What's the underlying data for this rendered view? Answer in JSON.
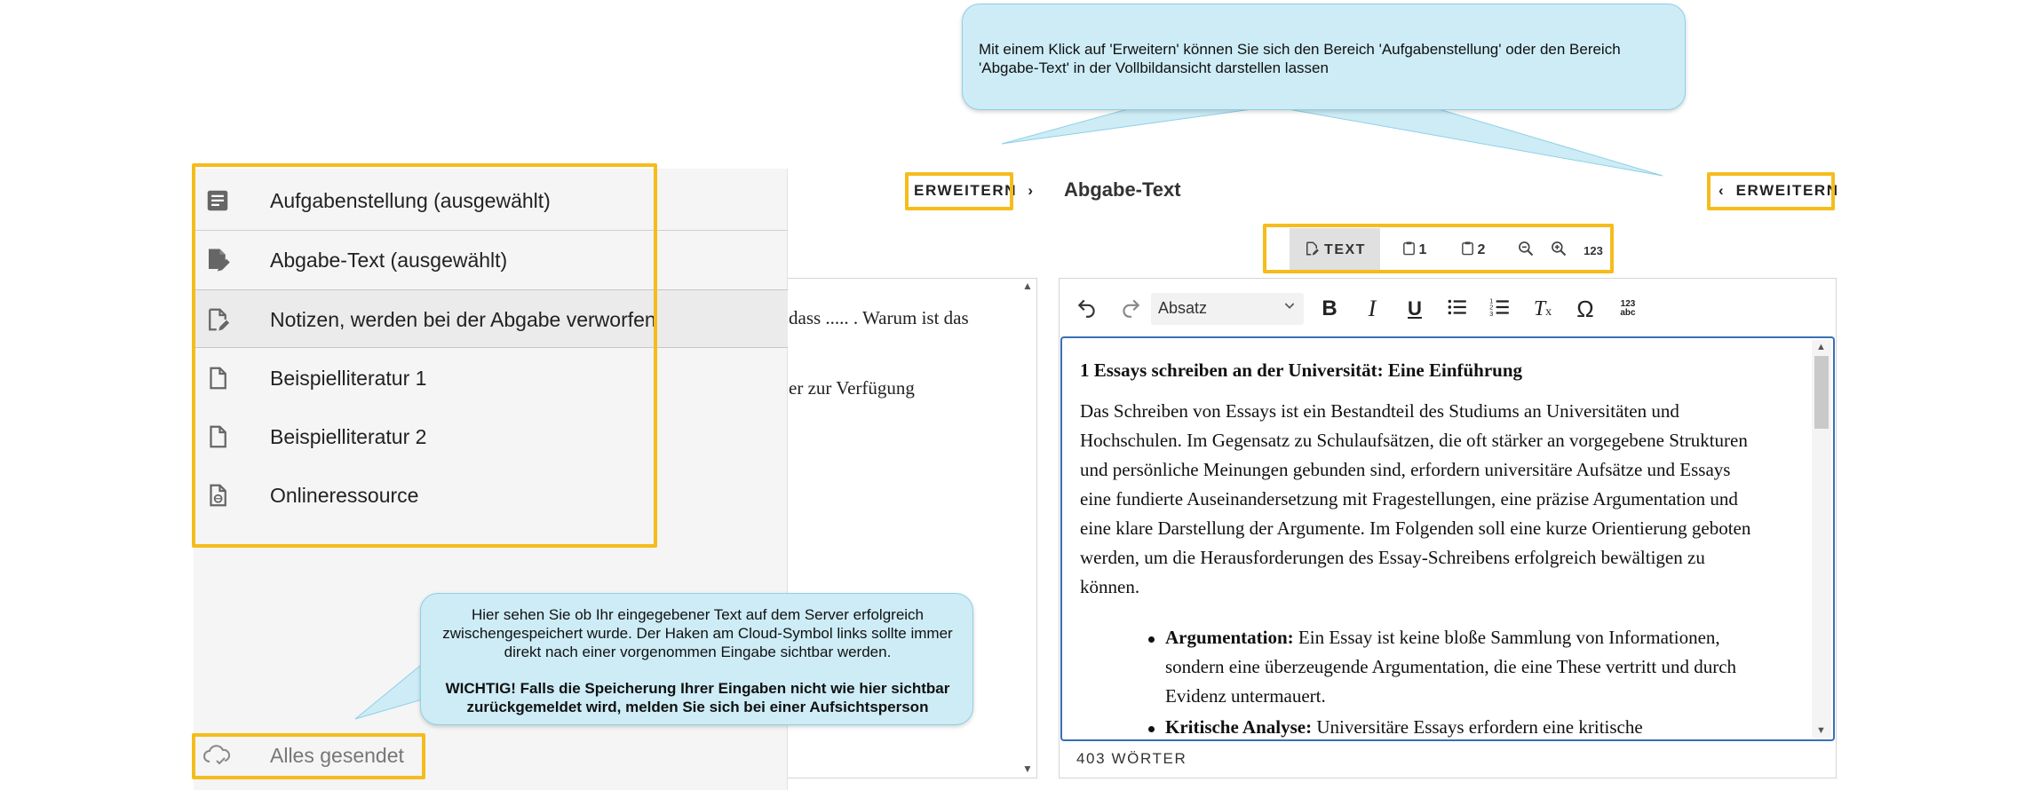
{
  "tooltip_top": {
    "text": "Mit einem Klick auf 'Erweitern' können Sie sich den Bereich 'Aufgabenstellung' oder den Bereich 'Abgabe-Text' in der Vollbildansicht darstellen lassen"
  },
  "tooltip_bottom": {
    "line1": "Hier sehen Sie ob Ihr eingegebener Text auf dem Server erfolgreich",
    "line2": "zwischengespeichert wurde. Der Haken am Cloud-Symbol links sollte immer",
    "line3": "direkt nach einer vorgenommen Eingabe sichtbar werden.",
    "warning1": "WICHTIG! Falls die Speicherung Ihrer Eingaben nicht wie hier sichtbar",
    "warning2": "zurückgemeldet wird, melden Sie sich bei einer Aufsichtsperson"
  },
  "sidebar": {
    "items": [
      {
        "label": "Aufgabenstellung (ausgewählt)",
        "icon": "document-icon"
      },
      {
        "label": "Abgabe-Text (ausgewählt)",
        "icon": "edit-document-icon"
      },
      {
        "label": "Notizen, werden bei der Abgabe verworfen",
        "icon": "edit-outline-icon"
      },
      {
        "label": "Beispielliteratur 1",
        "icon": "file-outline-icon"
      },
      {
        "label": "Beispielliteratur 2",
        "icon": "file-outline-icon"
      },
      {
        "label": "Onlineressource",
        "icon": "web-resource-icon"
      }
    ],
    "save_status": "Alles gesendet"
  },
  "left_panel": {
    "expand_label": "ERWEITERN",
    "text_line1": "dass ..... . Warum ist das",
    "text_line2": "er zur Verfügung"
  },
  "right_panel": {
    "title": "Abgabe-Text",
    "expand_label": "ERWEITERN",
    "view_tabs": {
      "text": "TEXT",
      "note1": "1",
      "note2": "2",
      "chars": "123"
    },
    "format_select": "Absatz",
    "heading": "1 Essays schreiben an der Universität: Eine Einführung",
    "para_lines": [
      "Das Schreiben von Essays ist ein Bestandteil des Studiums an Universitäten und",
      "Hochschulen. Im Gegensatz zu Schulaufsätzen, die oft stärker an vorgegebene Strukturen",
      "und persönliche Meinungen gebunden sind, erfordern universitäre Aufsätze und Essays",
      "eine fundierte Auseinandersetzung mit Fragestellungen, eine präzise Argumentation und",
      "eine klare Darstellung der Argumente. Im Folgenden soll eine kurze Orientierung geboten",
      "werden, um die Herausforderungen des Essay-Schreibens erfolgreich bewältigen zu",
      "können."
    ],
    "bullet1_bold": "Argumentation:",
    "bullet1_line1": " Ein Essay ist keine bloße Sammlung von Informationen,",
    "bullet1_line2": "sondern eine überzeugende Argumentation, die eine These vertritt und durch",
    "bullet1_line3": "Evidenz untermauert.",
    "bullet2_bold": "Kritische Analyse:",
    "bullet2_line1": " Universitäre Essays erfordern eine kritische",
    "word_count": "403 WÖRTER"
  },
  "colors": {
    "highlight": "#f5bc1c",
    "callout_bg": "#cdecf6",
    "editor_border": "#3a6fb6"
  }
}
